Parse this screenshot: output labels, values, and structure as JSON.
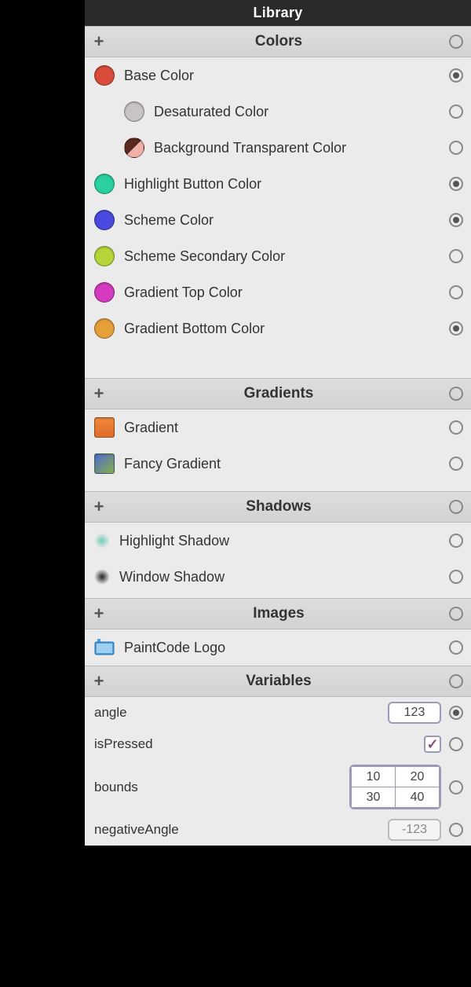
{
  "title": "Library",
  "sections": {
    "colors": {
      "title": "Colors",
      "items": [
        {
          "label": "Base Color",
          "swatch": "#d94c3a",
          "selected": true,
          "child": false,
          "type": "solid"
        },
        {
          "label": "Desaturated Color",
          "swatch": "#c9c4c4",
          "selected": false,
          "child": true,
          "type": "solid"
        },
        {
          "label": "Background Transparent Color",
          "swatch": "split",
          "selected": false,
          "child": true,
          "type": "split"
        },
        {
          "label": "Highlight Button Color",
          "swatch": "#2ad0a0",
          "selected": true,
          "child": false,
          "type": "solid"
        },
        {
          "label": "Scheme Color",
          "swatch": "#4a4ae0",
          "selected": true,
          "child": false,
          "type": "solid"
        },
        {
          "label": "Scheme Secondary Color",
          "swatch": "#b4d63a",
          "selected": false,
          "child": false,
          "type": "solid"
        },
        {
          "label": "Gradient Top Color",
          "swatch": "#d63ac0",
          "selected": false,
          "child": false,
          "type": "solid"
        },
        {
          "label": "Gradient Bottom Color",
          "swatch": "#e6a03a",
          "selected": true,
          "child": false,
          "type": "solid"
        }
      ]
    },
    "gradients": {
      "title": "Gradients",
      "items": [
        {
          "label": "Gradient",
          "gradient": "linear-gradient(180deg,#f08a3a,#e06a2a)",
          "selected": false
        },
        {
          "label": "Fancy Gradient",
          "gradient": "linear-gradient(135deg,#4a6ad0,#8ab04a)",
          "selected": false
        }
      ]
    },
    "shadows": {
      "title": "Shadows",
      "items": [
        {
          "label": "Highlight Shadow",
          "color": "#6ecbb8",
          "selected": false
        },
        {
          "label": "Window Shadow",
          "color": "#333",
          "selected": false
        }
      ]
    },
    "images": {
      "title": "Images",
      "items": [
        {
          "label": "PaintCode Logo",
          "selected": false
        }
      ]
    },
    "variables": {
      "title": "Variables",
      "angle": {
        "label": "angle",
        "value": "123",
        "selected": true
      },
      "isPressed": {
        "label": "isPressed",
        "checked": true,
        "selected": false
      },
      "bounds": {
        "label": "bounds",
        "values": [
          "10",
          "20",
          "30",
          "40"
        ],
        "selected": false
      },
      "negativeAngle": {
        "label": "negativeAngle",
        "value": "-123",
        "selected": false
      }
    }
  }
}
